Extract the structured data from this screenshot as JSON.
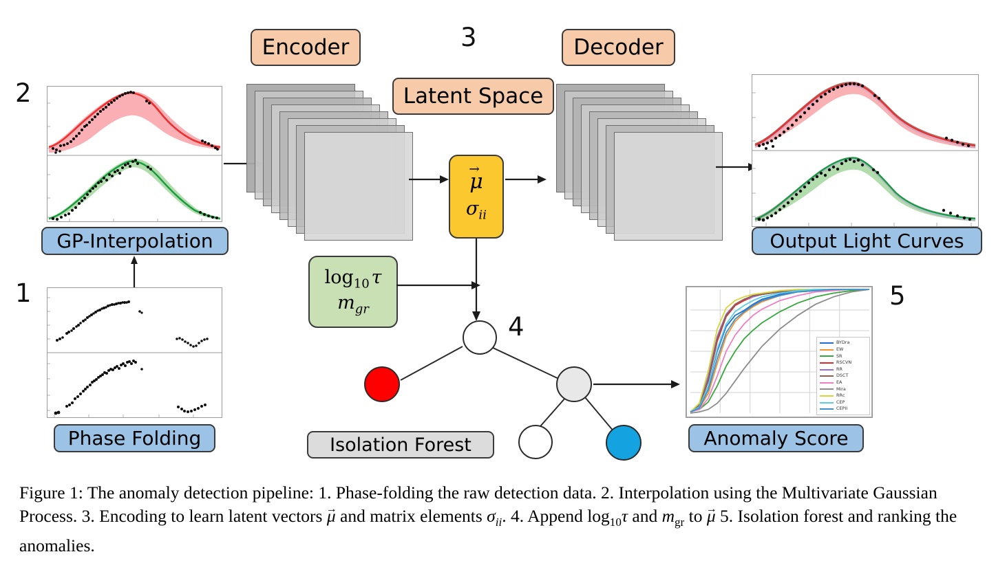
{
  "figure": {
    "caption_prefix": "Figure 1:",
    "caption_p1": " The anomaly detection pipeline: 1. Phase-folding the raw detection data. 2. Interpolation using the Multivariate Gaussian Process. 3. Encoding to learn latent vectors ",
    "caption_p2": " and matrix elements ",
    "caption_p3": ". 4. Append log",
    "caption_p4": " and ",
    "caption_p5": " to ",
    "caption_p6": " 5. Isolation forest and ranking the anomalies."
  },
  "stage_numbers": {
    "one": "1",
    "two": "2",
    "three": "3",
    "four": "4",
    "five": "5"
  },
  "labels": {
    "phase_folding": "Phase Folding",
    "gp_interpolation": "GP-Interpolation",
    "encoder": "Encoder",
    "latent_space": "Latent Space",
    "decoder": "Decoder",
    "output_light_curves": "Output Light Curves",
    "isolation_forest": "Isolation Forest",
    "anomaly_score": "Anomaly Score"
  },
  "latent_box": {
    "mu": "μ",
    "sigma": "σ",
    "sigma_sub": "ii"
  },
  "features_box": {
    "log_text": "log",
    "log_sub": "10",
    "tau": "τ",
    "m": "m",
    "m_sub": "gr"
  },
  "colors": {
    "chip_blue": "#9CC3E5",
    "chip_orange": "#F7CBAA",
    "chip_gray": "#DCDCDC",
    "latent_yellow": "#FBC92F",
    "features_green": "#C8E0B4",
    "curve_red": "#ED2F2F",
    "curve_green": "#159B3E",
    "band_red": "#F9A8AC",
    "band_green": "#A9D9A4",
    "node_anomaly_red": "#FF0000",
    "node_normal_blue": "#14A3E0",
    "node_gray": "#E8E8E8",
    "node_white": "#FFFFFF",
    "card_gray": "#CFCFCF",
    "stroke": "#3A3A3A"
  },
  "chart_data": {
    "type": "line",
    "title": "",
    "xlabel": "",
    "ylabel": "",
    "xlim": [
      0,
      1
    ],
    "ylim": [
      0,
      1
    ],
    "grid": true,
    "legend_position": "lower-right",
    "x": [
      0.0,
      0.05,
      0.1,
      0.15,
      0.2,
      0.25,
      0.3,
      0.35,
      0.4,
      0.5,
      0.6,
      0.7,
      0.8,
      0.9,
      1.0
    ],
    "series": [
      {
        "name": "BYDra",
        "color": "#1F6FD0",
        "values": [
          0.01,
          0.05,
          0.22,
          0.5,
          0.7,
          0.79,
          0.83,
          0.88,
          0.92,
          0.96,
          0.98,
          0.99,
          1.0,
          1.0,
          1.0
        ]
      },
      {
        "name": "EW",
        "color": "#F59331",
        "values": [
          0.01,
          0.04,
          0.16,
          0.4,
          0.62,
          0.74,
          0.81,
          0.86,
          0.9,
          0.95,
          0.98,
          0.99,
          1.0,
          1.0,
          1.0
        ]
      },
      {
        "name": "SR",
        "color": "#35A83B",
        "values": [
          0.01,
          0.03,
          0.09,
          0.22,
          0.38,
          0.5,
          0.6,
          0.67,
          0.73,
          0.82,
          0.89,
          0.94,
          0.97,
          0.99,
          1.0
        ]
      },
      {
        "name": "RSCVN",
        "color": "#E02B2B",
        "values": [
          0.01,
          0.06,
          0.26,
          0.58,
          0.78,
          0.87,
          0.91,
          0.94,
          0.96,
          0.98,
          0.99,
          1.0,
          1.0,
          1.0,
          1.0
        ]
      },
      {
        "name": "RR",
        "color": "#9B6FD0",
        "values": [
          0.01,
          0.07,
          0.3,
          0.62,
          0.8,
          0.88,
          0.92,
          0.94,
          0.96,
          0.98,
          0.99,
          1.0,
          1.0,
          1.0,
          1.0
        ]
      },
      {
        "name": "DSCT",
        "color": "#8C6057",
        "values": [
          0.01,
          0.06,
          0.27,
          0.6,
          0.79,
          0.88,
          0.92,
          0.95,
          0.96,
          0.98,
          0.99,
          1.0,
          1.0,
          1.0,
          1.0
        ]
      },
      {
        "name": "EA",
        "color": "#EE7FC4",
        "values": [
          0.01,
          0.03,
          0.12,
          0.3,
          0.5,
          0.63,
          0.72,
          0.79,
          0.84,
          0.91,
          0.95,
          0.98,
          0.99,
          1.0,
          1.0
        ]
      },
      {
        "name": "Mira",
        "color": "#8C8C8C",
        "values": [
          0.0,
          0.01,
          0.03,
          0.08,
          0.16,
          0.26,
          0.36,
          0.45,
          0.54,
          0.68,
          0.79,
          0.88,
          0.94,
          0.98,
          1.0
        ]
      },
      {
        "name": "RRc",
        "color": "#D6D63A",
        "values": [
          0.01,
          0.08,
          0.34,
          0.68,
          0.85,
          0.91,
          0.94,
          0.96,
          0.97,
          0.99,
          1.0,
          1.0,
          1.0,
          1.0,
          1.0
        ]
      },
      {
        "name": "CEP",
        "color": "#59CDEA",
        "values": [
          0.01,
          0.05,
          0.22,
          0.52,
          0.72,
          0.82,
          0.87,
          0.91,
          0.94,
          0.97,
          0.99,
          1.0,
          1.0,
          1.0,
          1.0
        ]
      },
      {
        "name": "CEPII",
        "color": "#3E8FCC",
        "values": [
          0.01,
          0.04,
          0.19,
          0.44,
          0.65,
          0.76,
          0.82,
          0.87,
          0.91,
          0.95,
          0.98,
          0.99,
          1.0,
          1.0,
          1.0
        ]
      }
    ]
  },
  "light_curves": {
    "top_curve_label": "red-band",
    "bottom_curve_label": "green-band"
  }
}
